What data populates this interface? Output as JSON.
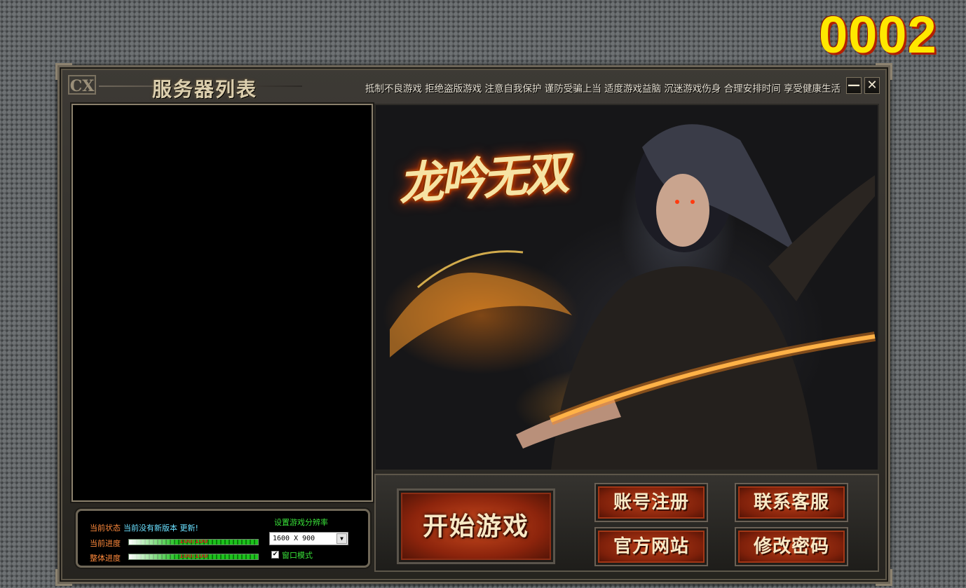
{
  "badge": "0002",
  "window": {
    "logo": "CX",
    "title": "服务器列表",
    "slogan": "抵制不良游戏 拒绝盗版游戏 注意自我保护 谨防受骗上当 适度游戏益脑 沉迷游戏伤身 合理安排时间 享受健康生活",
    "minimize": "—",
    "close": "✕"
  },
  "banner": {
    "logo_text": "龙吟无双"
  },
  "status": {
    "state_label": "当前状态",
    "state_msg": "当前没有新版本 更新!",
    "progress_label": "当前进度",
    "progress_text": "100/100",
    "progress_value": 1.0,
    "total_label": "整体进度",
    "total_text": "100/100",
    "total_value": 1.0,
    "resolution_label": "设置游戏分辨率",
    "resolution_value": "1600 X 900",
    "window_mode_label": "窗口模式",
    "window_mode_checked": true
  },
  "buttons": {
    "start": "开始游戏",
    "register": "账号注册",
    "support": "联系客服",
    "website": "官方网站",
    "password": "修改密码"
  },
  "icons": {
    "select_arrow": "▼",
    "check": "✔"
  },
  "colors": {
    "badge_yellow": "#ffe800",
    "status_label": "#ff8a3c",
    "status_msg": "#6ae0ff",
    "green_text": "#38e038",
    "button_red": "#b83e18"
  }
}
